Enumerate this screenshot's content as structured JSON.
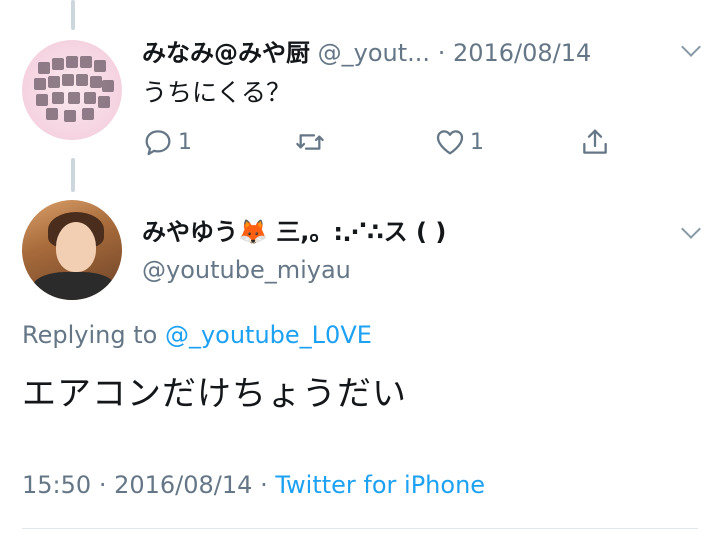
{
  "parent_tweet": {
    "author_name": "みなみ@みや厨",
    "handle": "@_yout...",
    "separator": "·",
    "date": "2016/08/14",
    "text": "うちにくる？",
    "reply_count": "1",
    "like_count": "1"
  },
  "main_tweet": {
    "author_name": "みやゆう🦊 三,。:⋰∴ス ( )",
    "handle": "@youtube_miyau",
    "replying_prefix": "Replying to",
    "replying_to": "@_youtube_L0VE",
    "text": "エアコンだけちょうだい",
    "time": "15:50",
    "separator": "·",
    "date": "2016/08/14",
    "source": "Twitter for iPhone"
  },
  "colors": {
    "accent": "#1da1f2",
    "muted": "#657786",
    "thread_line": "#ccd6dd"
  },
  "icons": [
    "reply-icon",
    "retweet-icon",
    "like-icon",
    "share-icon",
    "chevron-down-icon"
  ]
}
